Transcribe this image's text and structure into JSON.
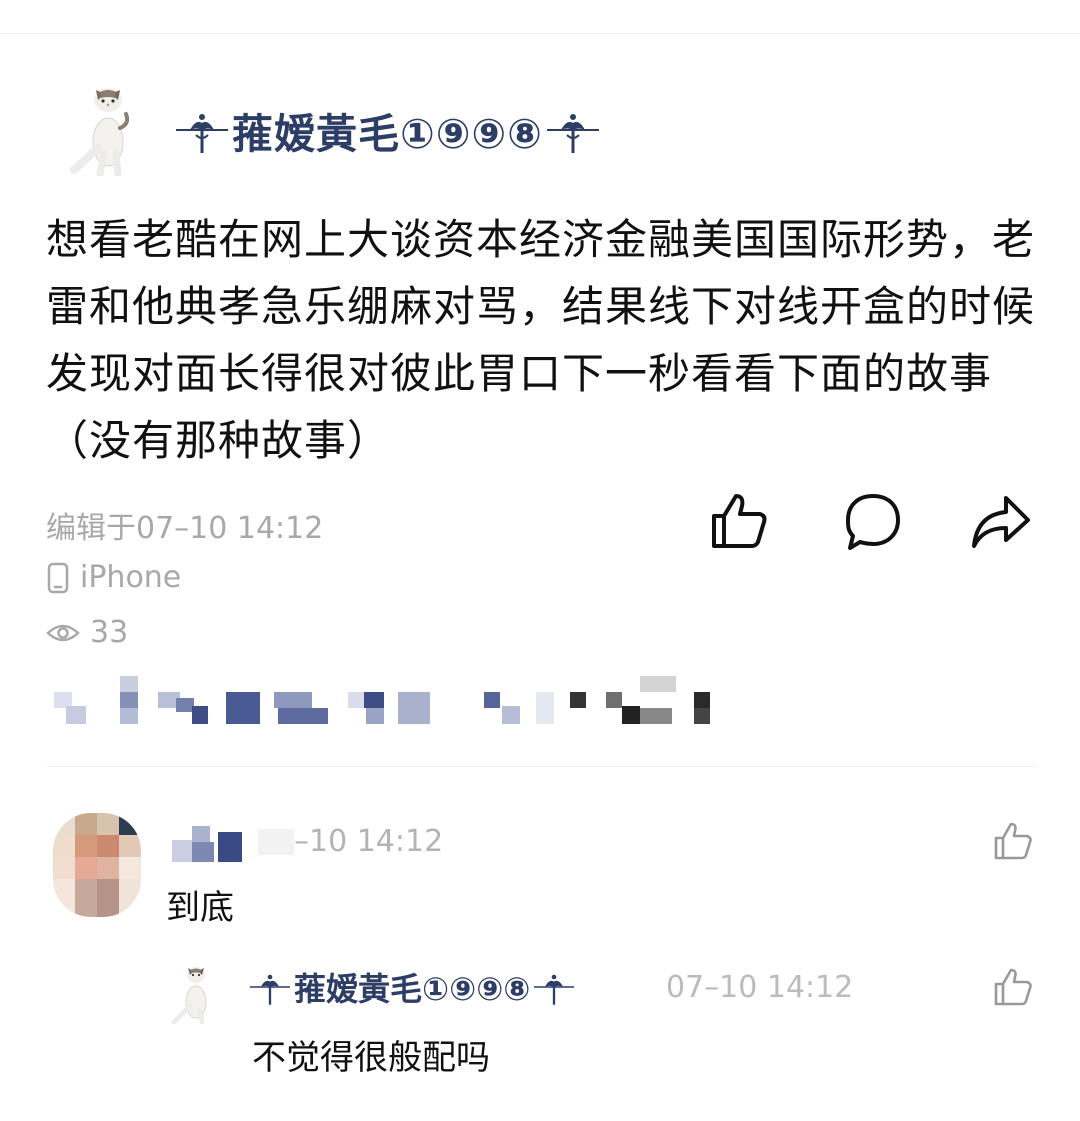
{
  "post": {
    "author_name": "蓷嫒黃毛①⑨⑨⑧",
    "text": "想看老酷在网上大谈资本经济金融美国国际形势，老雷和他典孝急乐绷麻对骂，结果线下对线开盒的时候发现对面长得很对彼此胃口下一秒看看下面的故事（没有那种故事）",
    "edited": "编辑于07–10 14:12",
    "device": "iPhone",
    "views": "33"
  },
  "comments": [
    {
      "time": "–10 14:12",
      "text": "到底",
      "replies": [
        {
          "author_name": "蓷嫒黃毛①⑨⑨⑧",
          "time": "07–10 14:12",
          "text": "不觉得很般配吗"
        }
      ]
    }
  ],
  "icons": [
    "avatar-cat",
    "thumbs-up-icon",
    "comment-bubble-icon",
    "share-arrow-icon",
    "phone-icon",
    "eye-icon"
  ],
  "colors": {
    "name": "#2c3d66",
    "meta": "#a8a8a8",
    "text": "#111111"
  }
}
